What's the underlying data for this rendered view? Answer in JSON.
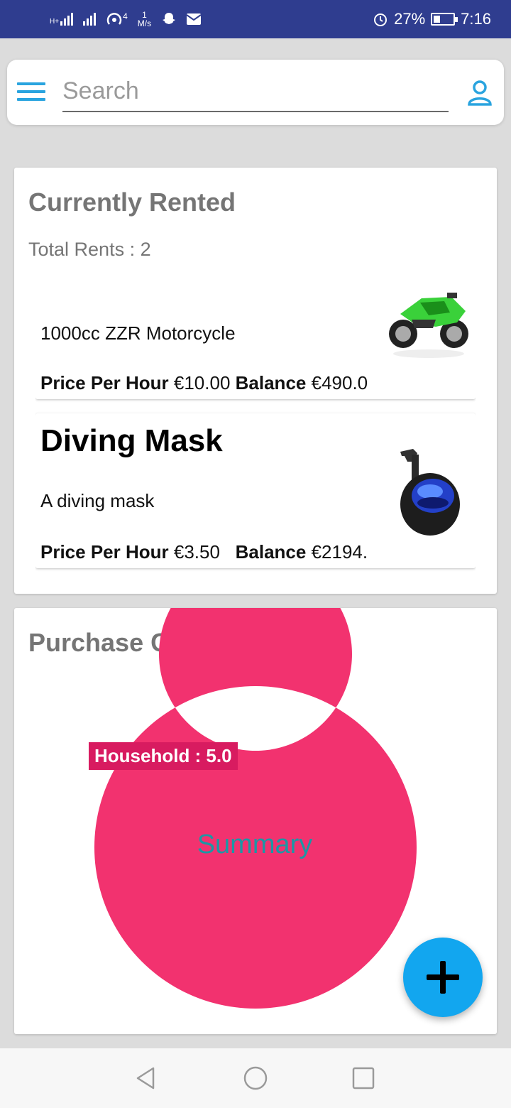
{
  "status_bar": {
    "network_label": "H+",
    "data_sub": "4",
    "speed_value": "1",
    "speed_unit": "M/s",
    "battery": "27%",
    "time": "7:16"
  },
  "search": {
    "placeholder": "Search"
  },
  "rented": {
    "title": "Currently Rented",
    "total_label": "Total Rents : 2",
    "items": [
      {
        "title": "",
        "description": "1000cc ZZR Motorcycle",
        "price_label": "Price Per Hour",
        "price_value": "€10.00",
        "balance_label": "Balance",
        "balance_value": "€490.0",
        "image_icon": "motorcycle-image"
      },
      {
        "title": "Diving Mask",
        "description": "A diving mask",
        "price_label": "Price Per Hour",
        "price_value": "€3.50",
        "balance_label": "Balance",
        "balance_value": "€2194.",
        "image_icon": "diving-mask-image"
      }
    ]
  },
  "categories": {
    "title": "Purchase Categories",
    "center_label": "Summary"
  },
  "chart_data": {
    "type": "pie",
    "categories": [
      "Household"
    ],
    "values": [
      5.0
    ],
    "slice_labels": [
      "Household : 5.0"
    ],
    "colors": [
      "#f2326f"
    ],
    "center_text": "Summary",
    "legend": "none"
  },
  "colors": {
    "status_bar": "#2f3d8f",
    "accent": "#2aa4df",
    "fab": "#12a6ef",
    "donut": "#f2326f",
    "label_bg": "#d81b60",
    "summary_text": "#1c97a5"
  },
  "fab": {
    "icon": "plus-icon"
  },
  "nav": {
    "back_icon": "back-triangle-icon",
    "home_icon": "home-circle-icon",
    "recents_icon": "recents-square-icon"
  }
}
